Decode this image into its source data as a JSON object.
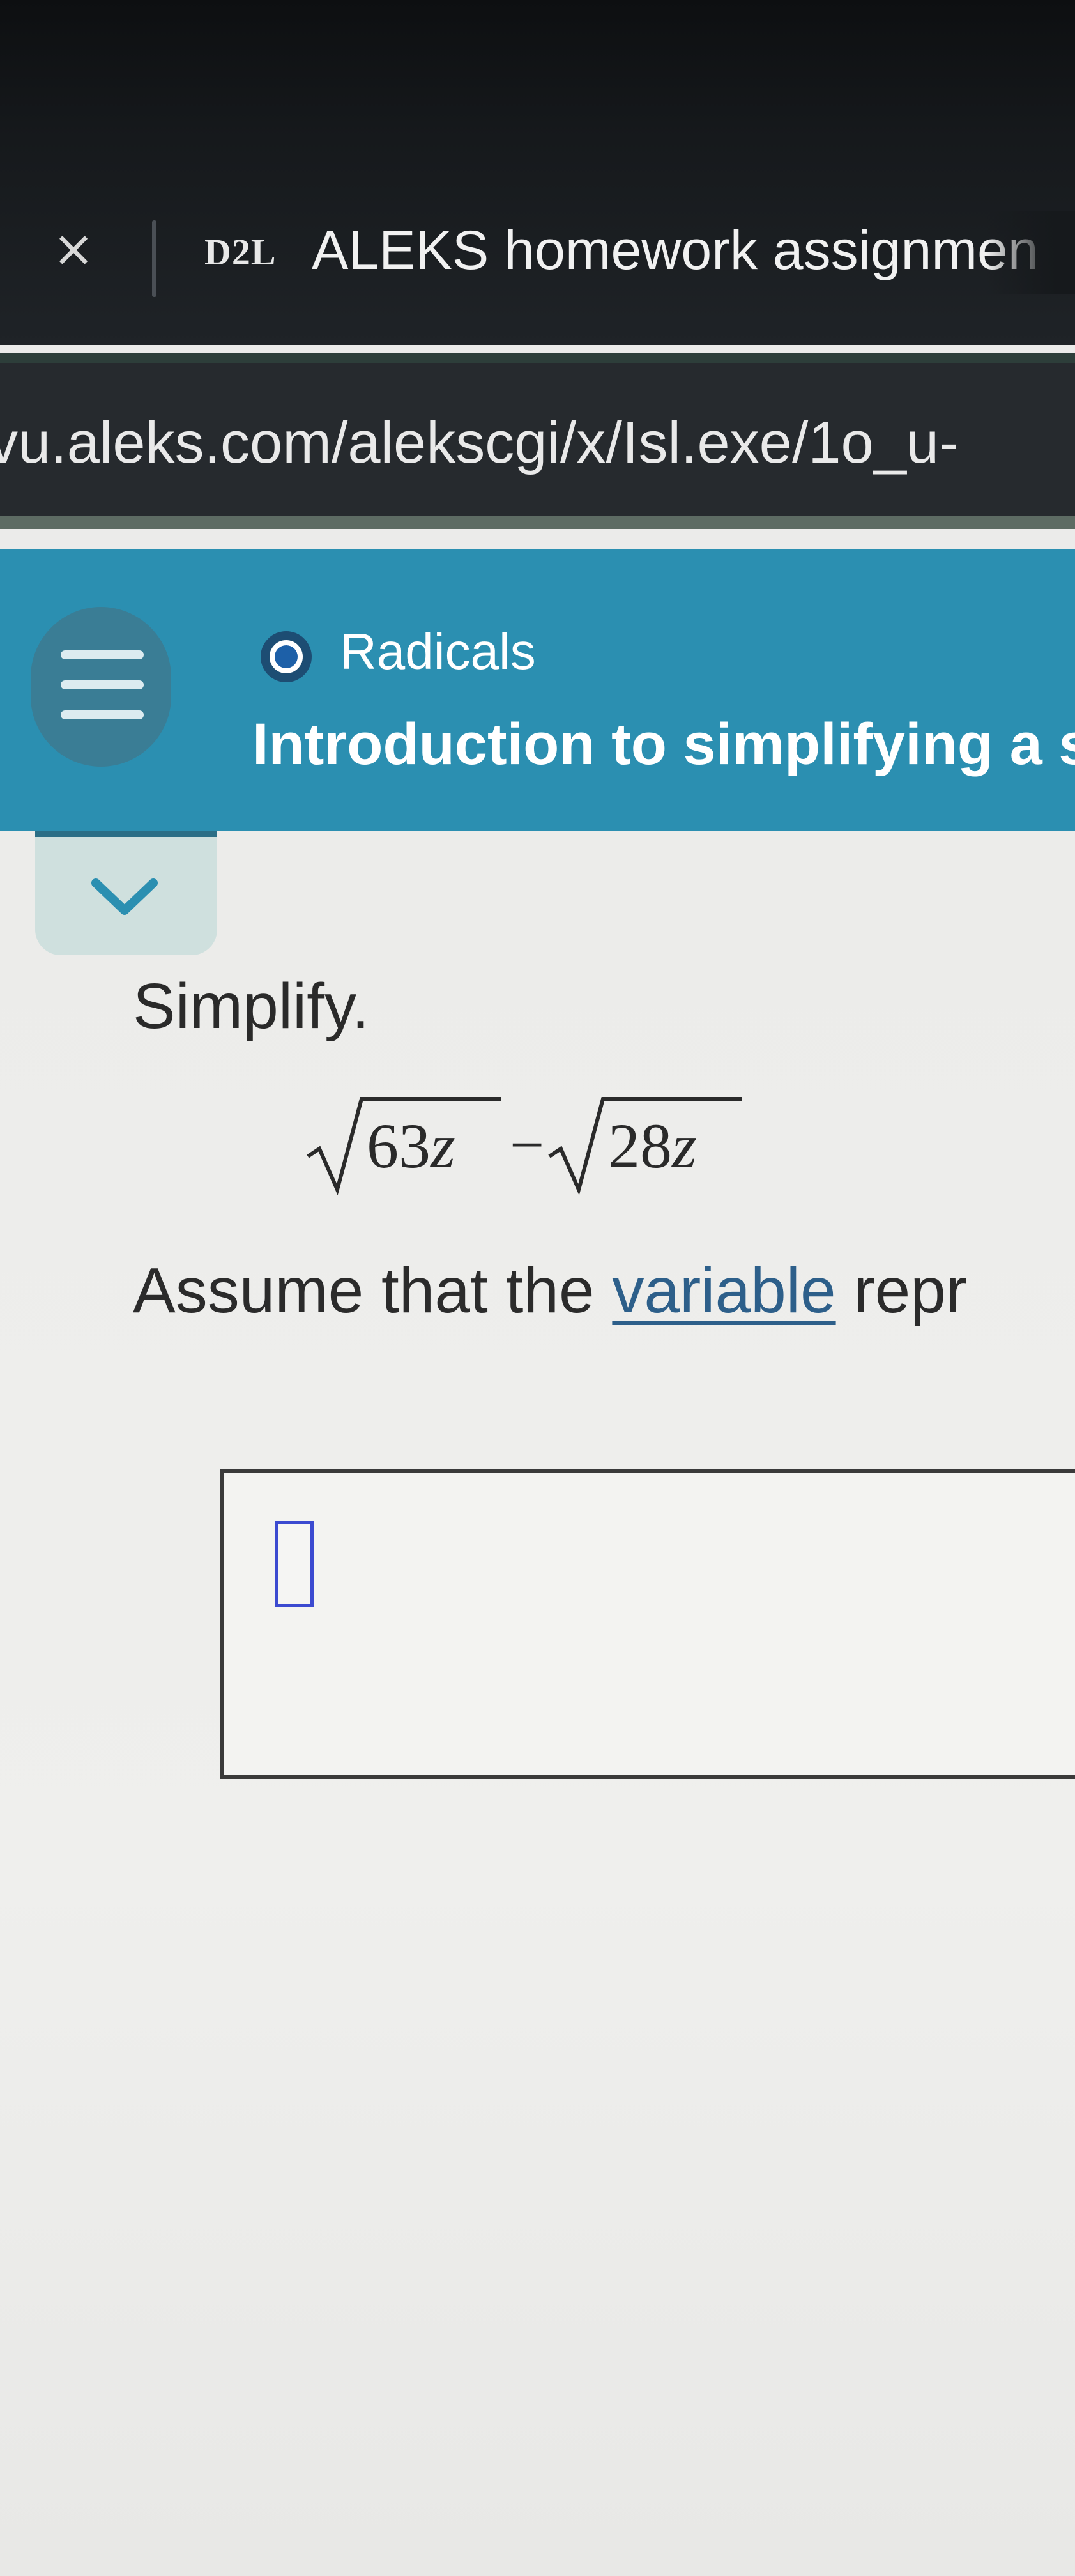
{
  "browser": {
    "tab": {
      "close_glyph": "×",
      "favicon_text": "D2L",
      "title": "ALEKS homework assignmen"
    },
    "url": "vu.aleks.com/alekscgi/x/Isl.exe/1o_u-"
  },
  "header": {
    "menu_icon": "hamburger-menu-icon",
    "topic_name": "Radicals",
    "topic_title": "Introduction to simplifying a s",
    "collapse_icon": "chevron-down-icon"
  },
  "problem": {
    "prompt": "Simplify.",
    "expression": {
      "term1_coefficient": "63",
      "term1_variable": "z",
      "operator": "−",
      "term2_coefficient": "28",
      "term2_variable": "z"
    },
    "assume_prefix": "Assume that the ",
    "assume_link": "variable",
    "assume_suffix": " repr"
  },
  "colors": {
    "header_bg": "#2b8fb1",
    "link": "#2d5f8a",
    "answer_input_border": "#3b4ad0"
  }
}
